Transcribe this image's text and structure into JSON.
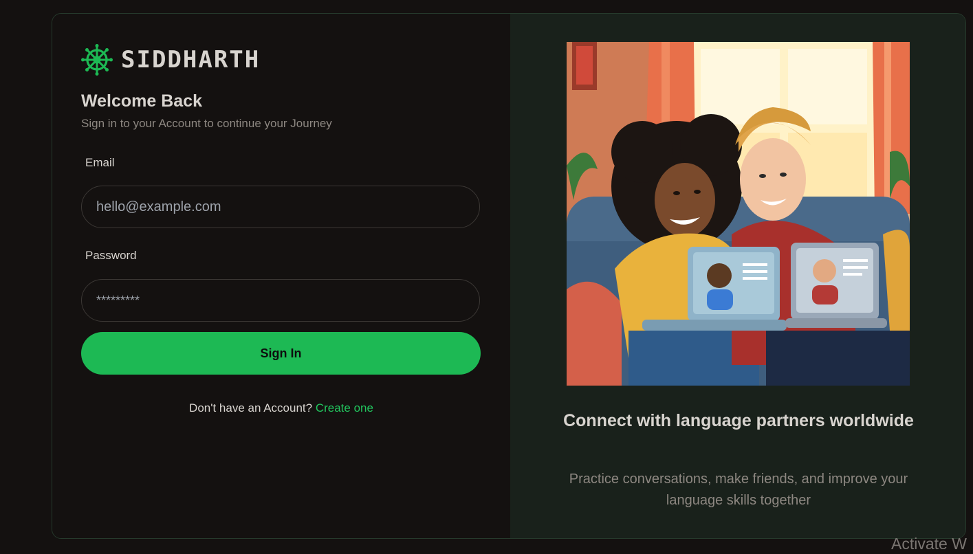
{
  "brand": {
    "name": "SIDDHARTH",
    "icon": "dharma-wheel-icon",
    "accent": "#22c55e"
  },
  "login": {
    "title": "Welcome Back",
    "subtitle": "Sign in to your Account to continue your Journey",
    "email_label": "Email",
    "email_value": "hello@example.com",
    "password_label": "Password",
    "password_value": "*********",
    "submit_label": "Sign In",
    "signup_prompt": "Don't have an Account?",
    "signup_link": "Create one"
  },
  "promo": {
    "title": "Connect with language partners worldwide",
    "body": "Practice conversations, make friends, and improve your language skills together"
  },
  "system": {
    "watermark": "Activate W"
  },
  "colors": {
    "background": "#141110",
    "panel": "#19211b",
    "button": "#1db954"
  }
}
